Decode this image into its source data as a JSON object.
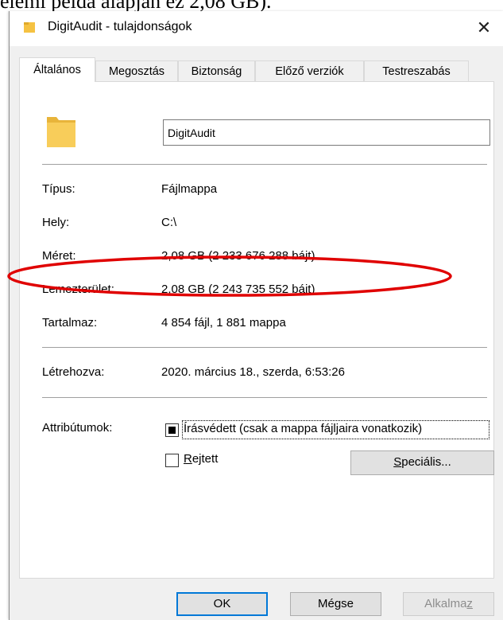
{
  "document": {
    "text": "elemi példa alapján ez 2,08 GB)."
  },
  "window": {
    "title": "DigitAudit - tulajdonságok",
    "close_glyph": "✕"
  },
  "tabs": [
    {
      "label": "Általános"
    },
    {
      "label": "Megosztás"
    },
    {
      "label": "Biztonság"
    },
    {
      "label": "Előző verziók"
    },
    {
      "label": "Testreszabás"
    }
  ],
  "general": {
    "name_value": "DigitAudit",
    "rows": [
      {
        "label": "Típus:",
        "value": "Fájlmappa"
      },
      {
        "label": "Hely:",
        "value": "C:\\"
      },
      {
        "label": "Méret:",
        "value": "2,08 GB (2 233 676 288 bájt)"
      },
      {
        "label": "Lemezterület:",
        "value": "2,08 GB (2 243 735 552 bájt)"
      },
      {
        "label": "Tartalmaz:",
        "value": "4 854 fájl, 1 881 mappa"
      },
      {
        "label": "Létrehozva:",
        "value": "2020. március 18., szerda, 6:53:26"
      }
    ],
    "attributes": {
      "label": "Attribútumok:",
      "readonly": {
        "label": "Írásvédett (csak a mappa fájljaira vonatkozik)",
        "state": "indeterminate"
      },
      "hidden": {
        "label_prefix": "R",
        "label_rest": "ejtett",
        "checked": false
      },
      "advanced_button": {
        "label_prefix": "S",
        "label_rest": "peciális..."
      }
    }
  },
  "footer": {
    "ok": "OK",
    "cancel": "Mégse",
    "apply_prefix": "Alkalma",
    "apply_ul": "z"
  },
  "colors": {
    "annotation": "#e00000",
    "focus_border": "#0078d7",
    "folder": "#f5c242"
  }
}
